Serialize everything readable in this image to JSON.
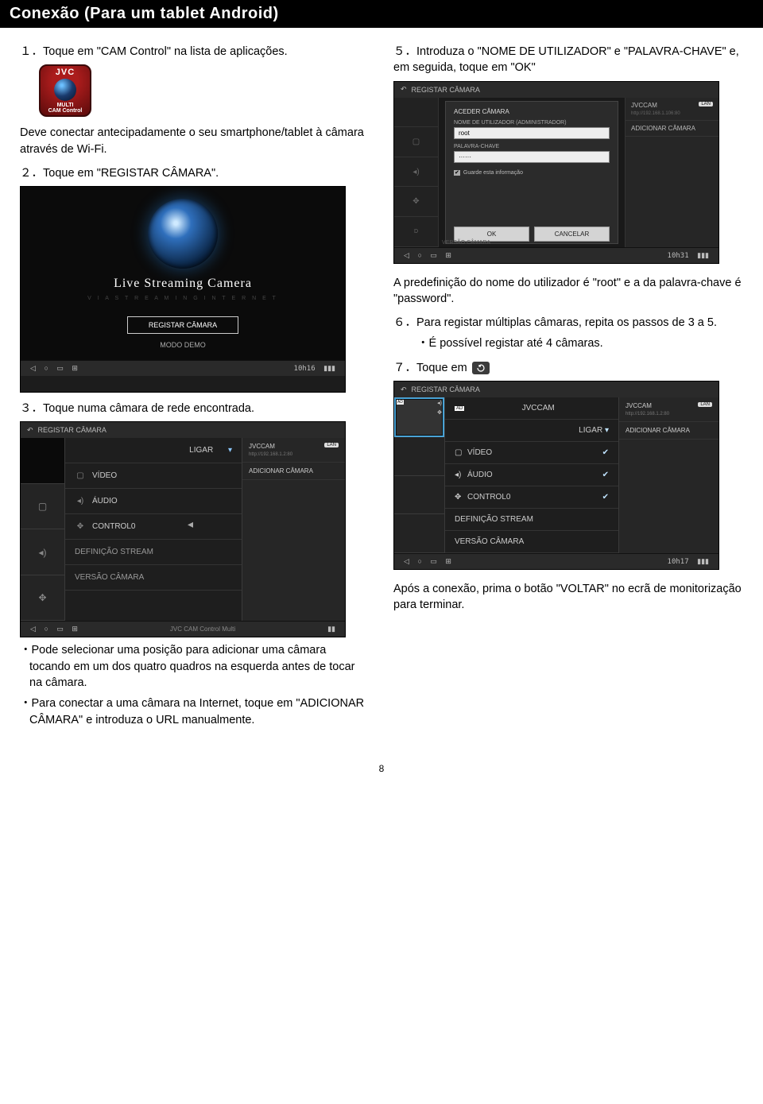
{
  "page_title": "Conexão (Para um tablet Android)",
  "page_number": "8",
  "left": {
    "step1": "１．Toque em \"CAM Control\" na lista de aplicações.",
    "app_icon": {
      "brand": "JVC",
      "multi": "MULTI",
      "caption": "CAM Control"
    },
    "note_connect": "Deve conectar antecipadamente o seu smartphone/tablet à câmara através de Wi-Fi.",
    "step2": "２．Toque em \"REGISTAR CÂMARA\".",
    "shot1": {
      "title": "Live Streaming Camera",
      "subtitle": "V I A   S T R E A M I N G   I N T E R N E T",
      "btn_registar": "REGISTAR CÂMARA",
      "btn_modo": "MODO DEMO",
      "time": "10h16"
    },
    "step3": "３．Toque numa câmara de rede encontrada.",
    "shot2": {
      "top_title": "REGISTAR CÂMARA",
      "ligar": "LIGAR",
      "video": "VÍDEO",
      "audio": "ÁUDIO",
      "control": "CONTROL0",
      "defstream": "DEFINIÇÃO STREAM",
      "versao": "VERSÃO CÂMARA",
      "right_cam": "JVCCAM",
      "right_sub": "http://192.168.1.2:80",
      "right_chip": "LAN",
      "right_add": "ADICIONAR CÂMARA",
      "footer_center": "JVC CAM Control Multi"
    },
    "bullet1": "・Pode selecionar uma posição para adicionar uma câmara tocando em um dos quatro quadros na esquerda antes de tocar na câmara.",
    "bullet2": "・Para conectar a uma câmara na Internet, toque em \"ADICIONAR CÂMARA\" e introduza o URL manualmente."
  },
  "right": {
    "step5": "５．Introduza o \"NOME DE UTILIZADOR\" e \"PALAVRA-CHAVE\" e, em seguida, toque em \"OK\"",
    "shot3": {
      "top_title": "REGISTAR CÂMARA",
      "dlg_title": "ACEDER CÂMARA",
      "user_label": "NOME DE UTILIZADOR (ADMINISTRADOR)",
      "user_value": "root",
      "pass_label": "PALAVRA-CHAVE",
      "pass_value": "······",
      "remember": "Guarde esta informação",
      "ok": "OK",
      "cancel": "CANCELAR",
      "right_cam": "JVCCAM",
      "right_sub": "http://192.168.1.106:80",
      "right_chip": "LAN",
      "right_add": "ADICIONAR CÂMARA",
      "versao": "VERSÃO CÂMARA",
      "time": "10h31"
    },
    "note_default": "A predefinição do nome do utilizador é \"root\" e a da palavra-chave é \"password\".",
    "step6": "６．Para registar múltiplas câmaras, repita os passos de 3 a 5.",
    "step6_sub": "・É possível registar até 4 câmaras.",
    "step7_pre": "７．Toque em",
    "shot4": {
      "top_title": "REGISTAR CÂMARA",
      "ad": "AD",
      "camname": "JVCCAM",
      "ligar": "LIGAR",
      "video": "VÍDEO",
      "audio": "ÁUDIO",
      "control": "CONTROL0",
      "defstream": "DEFINIÇÃO STREAM",
      "versao": "VERSÃO CÂMARA",
      "right_cam": "JVCCAM",
      "right_sub": "http://192.168.1.2:80",
      "right_chip": "LAN",
      "right_add": "ADICIONAR CÂMARA",
      "time": "10h17"
    },
    "note_after": "Após a conexão, prima o botão \"VOLTAR\" no ecrã de monitorização para terminar."
  },
  "nav_icons": {
    "back": "◁",
    "home": "○",
    "recent": "▭",
    "grid": "⊞",
    "sig": "▮▮▮",
    "batt": "▮▮"
  }
}
